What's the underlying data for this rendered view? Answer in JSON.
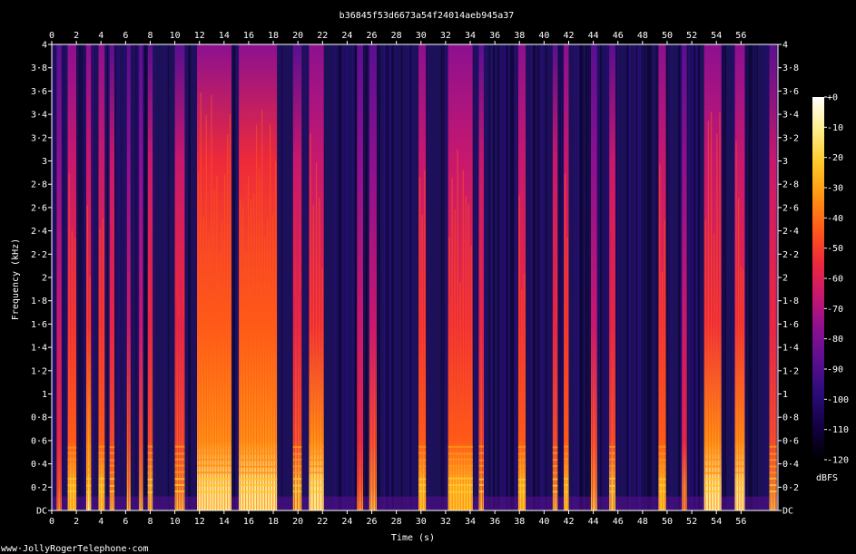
{
  "chart_data": {
    "type": "heatmap",
    "subtype": "spectrogram",
    "title": "b36845f53d6673a54f24014aeb945a37",
    "xlabel": "Time (s)",
    "ylabel": "Frequency (kHz)",
    "xlim": [
      0,
      59
    ],
    "ylim": [
      0,
      4
    ],
    "x_ticks": [
      "0",
      "2",
      "4",
      "6",
      "8",
      "10",
      "12",
      "14",
      "16",
      "18",
      "20",
      "22",
      "24",
      "26",
      "28",
      "30",
      "32",
      "34",
      "36",
      "38",
      "40",
      "42",
      "44",
      "46",
      "48",
      "50",
      "52",
      "54",
      "56"
    ],
    "y_ticks": [
      "DC",
      "0·2",
      "0·4",
      "0·6",
      "0·8",
      "1",
      "1·2",
      "1·4",
      "1·6",
      "1·8",
      "2",
      "2·2",
      "2·4",
      "2·6",
      "2·8",
      "3",
      "3·2",
      "3·4",
      "3·6",
      "3·8",
      "4"
    ],
    "colorbar": {
      "label": "dBFS",
      "ticks": [
        "+0",
        "-10",
        "-20",
        "-30",
        "-40",
        "-50",
        "-60",
        "-70",
        "-80",
        "-90",
        "-100",
        "-110",
        "-120"
      ],
      "range": [
        -120,
        0
      ],
      "colormap": [
        "#000000",
        "#140044",
        "#2a0c78",
        "#5a0f90",
        "#8c1090",
        "#c8186e",
        "#ee2a3a",
        "#ff5a18",
        "#ff9414",
        "#ffc828",
        "#ffee88",
        "#ffffff"
      ]
    },
    "background_color": "#1c1058",
    "activity_segments": [
      {
        "start": 0.4,
        "end": 0.8,
        "level": 0.35
      },
      {
        "start": 1.3,
        "end": 2.0,
        "level": 0.8
      },
      {
        "start": 2.8,
        "end": 3.2,
        "level": 0.85
      },
      {
        "start": 3.8,
        "end": 4.3,
        "level": 0.75
      },
      {
        "start": 4.7,
        "end": 5.1,
        "level": 0.6
      },
      {
        "start": 6.1,
        "end": 6.4,
        "level": 0.55
      },
      {
        "start": 7.1,
        "end": 7.4,
        "level": 0.5
      },
      {
        "start": 7.8,
        "end": 8.2,
        "level": 0.65
      },
      {
        "start": 10.0,
        "end": 10.8,
        "level": 0.6
      },
      {
        "start": 11.8,
        "end": 14.6,
        "level": 1.0
      },
      {
        "start": 15.2,
        "end": 18.3,
        "level": 1.0
      },
      {
        "start": 19.6,
        "end": 20.3,
        "level": 0.7
      },
      {
        "start": 20.9,
        "end": 22.1,
        "level": 0.9
      },
      {
        "start": 24.8,
        "end": 25.3,
        "level": 0.35
      },
      {
        "start": 25.8,
        "end": 26.4,
        "level": 0.5
      },
      {
        "start": 29.8,
        "end": 30.4,
        "level": 0.75
      },
      {
        "start": 32.2,
        "end": 34.2,
        "level": 0.8
      },
      {
        "start": 34.7,
        "end": 35.1,
        "level": 0.6
      },
      {
        "start": 37.9,
        "end": 38.5,
        "level": 0.8
      },
      {
        "start": 40.7,
        "end": 41.1,
        "level": 0.6
      },
      {
        "start": 41.6,
        "end": 42.0,
        "level": 0.75
      },
      {
        "start": 43.8,
        "end": 44.3,
        "level": 0.55
      },
      {
        "start": 45.3,
        "end": 45.8,
        "level": 0.7
      },
      {
        "start": 49.3,
        "end": 49.9,
        "level": 0.8
      },
      {
        "start": 51.2,
        "end": 51.6,
        "level": 0.4
      },
      {
        "start": 53.0,
        "end": 54.4,
        "level": 0.95
      },
      {
        "start": 55.5,
        "end": 56.3,
        "level": 0.9
      },
      {
        "start": 58.3,
        "end": 58.9,
        "level": 0.6
      }
    ],
    "grid": false,
    "legend": "right colorbar"
  },
  "footer": {
    "watermark": "www·JollyRogerTelephone·com"
  }
}
